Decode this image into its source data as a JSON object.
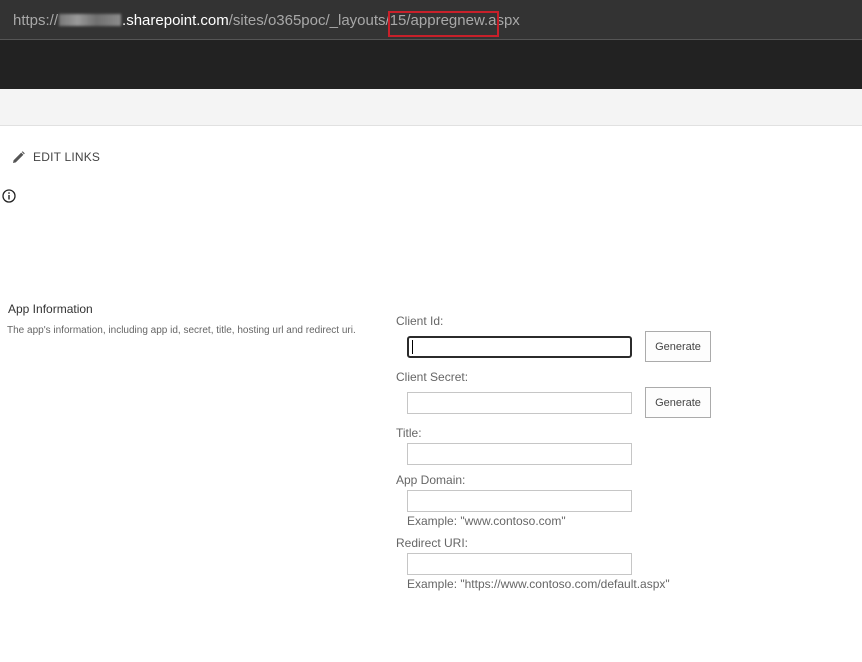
{
  "browser": {
    "url_prefix": "https://",
    "url_domain": ".sharepoint.com",
    "url_path": "/sites/o365poc/_layouts/15",
    "url_page": "/appregnew.aspx"
  },
  "nav": {
    "edit_links_label": "EDIT LINKS"
  },
  "app_info": {
    "title": "App Information",
    "description": "The app's information, including app id, secret, title, hosting url and redirect uri."
  },
  "form": {
    "client_id": {
      "label": "Client Id:",
      "value": "",
      "button": "Generate"
    },
    "client_secret": {
      "label": "Client Secret:",
      "value": "",
      "button": "Generate"
    },
    "title": {
      "label": "Title:",
      "value": ""
    },
    "app_domain": {
      "label": "App Domain:",
      "value": "",
      "example": "Example: \"www.contoso.com\""
    },
    "redirect_uri": {
      "label": "Redirect URI:",
      "value": "",
      "example": "Example: \"https://www.contoso.com/default.aspx\""
    }
  },
  "colors": {
    "address_bar": "#333333",
    "suite_bar": "#222222",
    "highlight": "#c8202a"
  }
}
